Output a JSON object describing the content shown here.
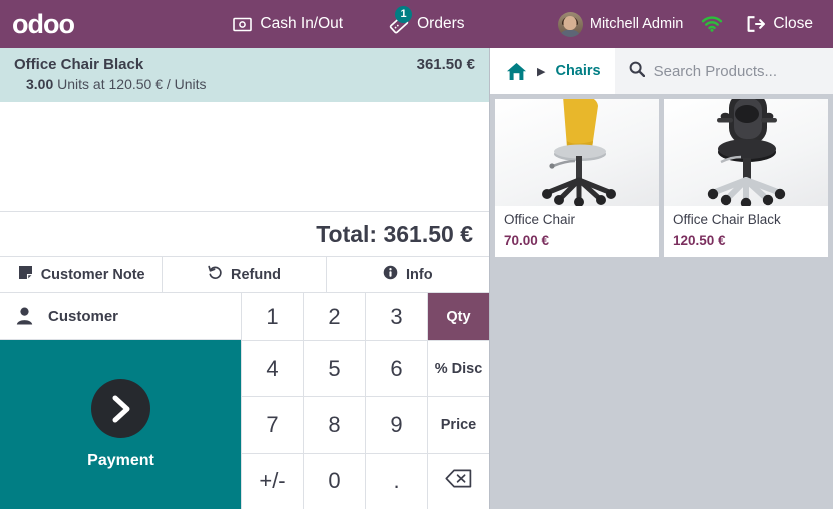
{
  "topbar": {
    "brand": "odoo",
    "cash_label": "Cash In/Out",
    "cash_icon": "banknote-icon",
    "orders_label": "Orders",
    "orders_icon": "ticket-icon",
    "orders_badge": "1",
    "user_name": "Mitchell Admin",
    "wifi_icon": "wifi-icon",
    "close_label": "Close",
    "close_icon": "sign-out-icon",
    "colors": {
      "bar": "#78416c",
      "badge": "#017e84",
      "wifi": "#2dbd3c"
    }
  },
  "order": {
    "lines": [
      {
        "name": "Office Chair Black",
        "price": "361.50 €",
        "qty": "3.00",
        "detail": "Units at 120.50 € / Units",
        "selected": true
      }
    ],
    "total_label": "Total: 361.50 €",
    "actions": [
      {
        "label": "Customer Note",
        "icon": "note-icon"
      },
      {
        "label": "Refund",
        "icon": "undo-icon"
      },
      {
        "label": "Info",
        "icon": "info-circle-icon"
      }
    ]
  },
  "numpad": {
    "customer_label": "Customer",
    "customer_icon": "user-icon",
    "payment_label": "Payment",
    "payment_icon": "chevron-right-icon",
    "keys": [
      {
        "label": "1",
        "type": "digit"
      },
      {
        "label": "2",
        "type": "digit"
      },
      {
        "label": "3",
        "type": "digit"
      },
      {
        "label": "Qty",
        "type": "mode",
        "active": true
      },
      {
        "label": "4",
        "type": "digit"
      },
      {
        "label": "5",
        "type": "digit"
      },
      {
        "label": "6",
        "type": "digit"
      },
      {
        "label": "% Disc",
        "type": "mode",
        "active": false
      },
      {
        "label": "7",
        "type": "digit"
      },
      {
        "label": "8",
        "type": "digit"
      },
      {
        "label": "9",
        "type": "digit"
      },
      {
        "label": "Price",
        "type": "mode",
        "active": false
      },
      {
        "label": "+/-",
        "type": "digit"
      },
      {
        "label": "0",
        "type": "digit"
      },
      {
        "label": ".",
        "type": "digit"
      },
      {
        "label": "",
        "type": "backspace",
        "icon": "backspace-icon"
      }
    ],
    "colors": {
      "active_mode": "#7b4a69",
      "payment": "#017e84"
    }
  },
  "products": {
    "home_icon": "home-icon",
    "caret_icon": "caret-right-icon",
    "category": "Chairs",
    "search_icon": "search-icon",
    "search_value": "",
    "search_placeholder": "Search Products...",
    "items": [
      {
        "name": "Office Chair",
        "price": "70.00 €",
        "image": "yellow-office-chair"
      },
      {
        "name": "Office Chair Black",
        "price": "120.50 €",
        "image": "black-office-chair"
      }
    ]
  }
}
